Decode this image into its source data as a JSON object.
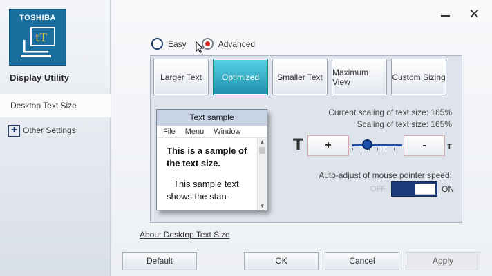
{
  "brand": "TOSHIBA",
  "app": {
    "title": "Display Utility"
  },
  "sidebar": {
    "items": [
      {
        "label": "Desktop Text Size"
      },
      {
        "label": "Other Settings"
      }
    ]
  },
  "mode": {
    "easy_label": "Easy",
    "advanced_label": "Advanced",
    "selected": "Advanced"
  },
  "presets": [
    {
      "label": "Larger Text"
    },
    {
      "label": "Optimized",
      "selected": true
    },
    {
      "label": "Smaller Text"
    },
    {
      "label": "Maximum View"
    },
    {
      "label": "Custom Sizing"
    }
  ],
  "sample": {
    "title": "Text sample",
    "menu": [
      "File",
      "Menu",
      "Window"
    ],
    "bold_text": "This is a sample of the text size.",
    "body_text": "This sample text shows the stan-"
  },
  "scaling": {
    "current_label": "Current scaling of text size:",
    "current_value": "165%",
    "scaling_label": "Scaling of text size:",
    "scaling_value": "165%"
  },
  "slider": {
    "large_glyph": "T",
    "small_glyph": "T",
    "plus_label": "+",
    "minus_label": "-",
    "level": 0.3
  },
  "mouse": {
    "label": "Auto-adjust of mouse pointer speed:",
    "off_label": "OFF",
    "on_label": "ON",
    "state": "ON"
  },
  "about_link": "About Desktop Text Size",
  "buttons": {
    "default": "Default",
    "ok": "OK",
    "cancel": "Cancel",
    "apply": "Apply"
  },
  "colors": {
    "accent": "#1f8fae",
    "brand_blue": "#1a6f9e",
    "toggle_on": "#1c3a78",
    "radio_selected": "#d92b2b"
  }
}
